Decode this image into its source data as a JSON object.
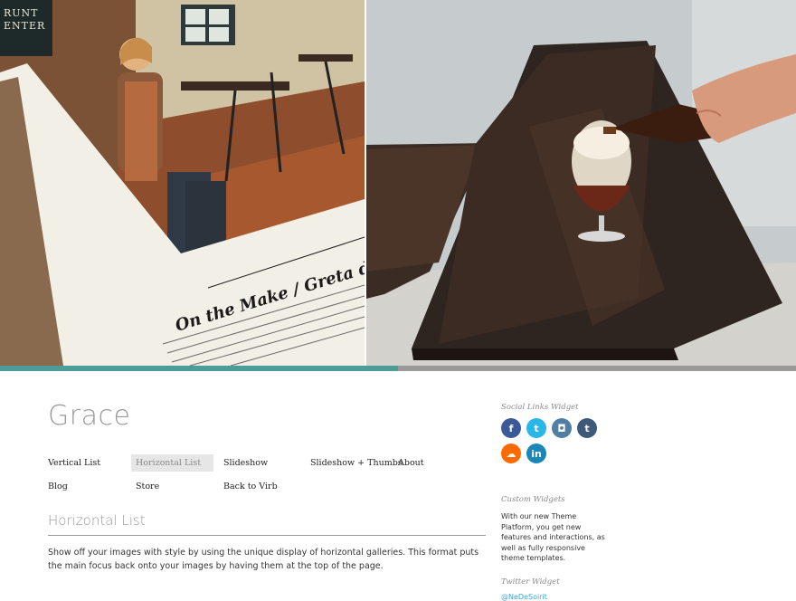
{
  "gallery": {
    "article_heading": "On the Make / Greta de Parry",
    "sign_text": "RUNT\nENTER",
    "progress_fraction": 0.5
  },
  "site": {
    "title": "Grace"
  },
  "nav": [
    {
      "label": "Vertical List"
    },
    {
      "label": "Horizontal List",
      "active": true
    },
    {
      "label": "Slideshow"
    },
    {
      "label": "Slideshow + Thumbs"
    },
    {
      "label": "About"
    },
    {
      "label": "Blog"
    },
    {
      "label": "Store"
    },
    {
      "label": "Back to Virb"
    }
  ],
  "main": {
    "section_title": "Horizontal List",
    "body": "Show off your images with style by using the unique display of horizontal galleries. This format puts the main focus back onto your images by having them at the top of the page."
  },
  "sidebar": {
    "social_title": "Social Links Widget",
    "social_links": [
      {
        "icon": "facebook-icon",
        "glyph": "f",
        "color": "#3b5998"
      },
      {
        "icon": "twitter-icon",
        "glyph": "t",
        "color": "#29b6e8"
      },
      {
        "icon": "instagram-icon",
        "glyph": "◘",
        "color": "#517fa4"
      },
      {
        "icon": "tumblr-icon",
        "glyph": "t",
        "color": "#3f5a78"
      },
      {
        "icon": "soundcloud-icon",
        "glyph": "☁",
        "color": "#ff6a00"
      },
      {
        "icon": "linkedin-icon",
        "glyph": "in",
        "color": "#1b87b9"
      }
    ],
    "custom_title": "Custom Widgets",
    "custom_text": "With our new Theme Platform, you get new features and interactions, as well as fully responsive theme templates.",
    "twitter_title": "Twitter Widget",
    "twitter_handle": "@NeDeSoirit"
  },
  "colors": {
    "accent": "#4e9c98",
    "muted": "#9a9a9a"
  }
}
